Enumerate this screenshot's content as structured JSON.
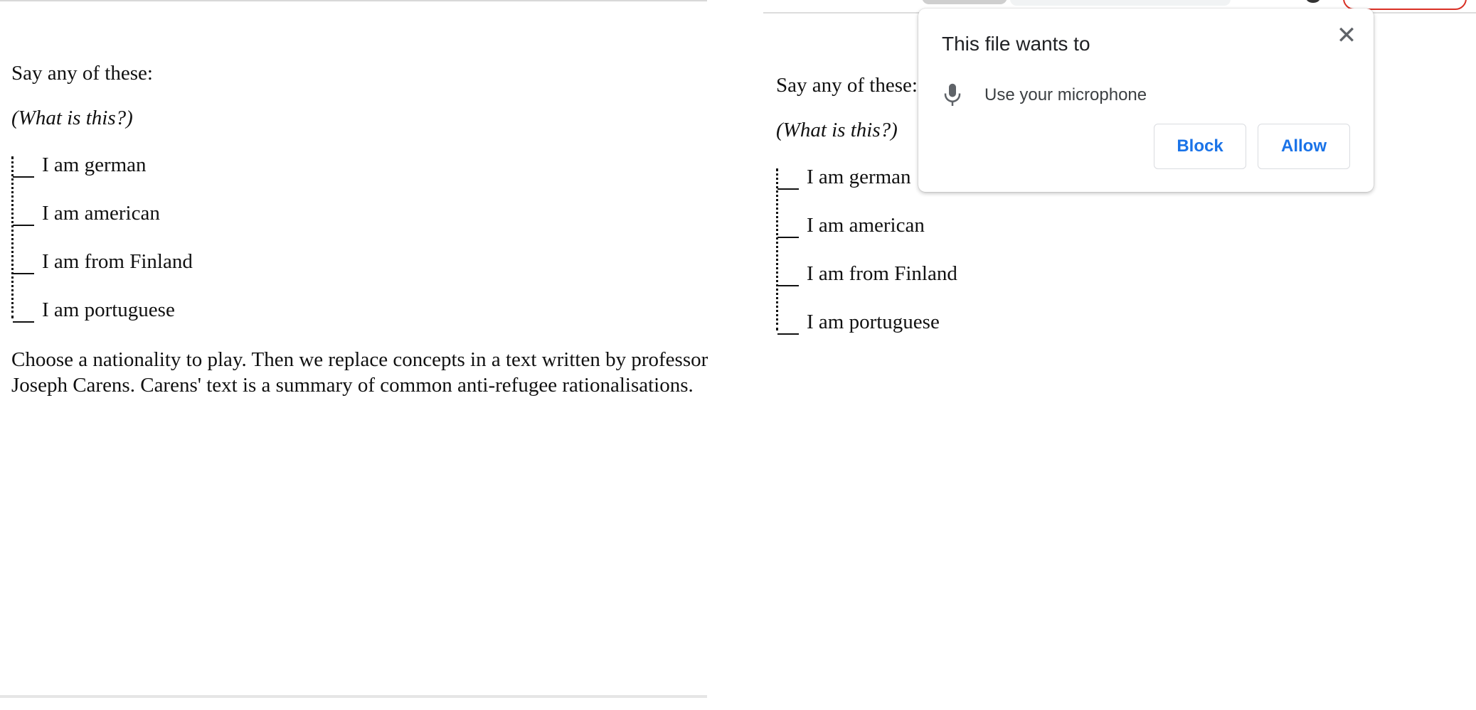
{
  "left_page": {
    "prompt": "Say any of these:",
    "what_is_this": "(What is this?)",
    "options": [
      "I am german",
      "I am american",
      "I am from Finland",
      "I am portuguese"
    ],
    "description": "Choose a nationality to play. Then we replace concepts in a text written by professor Joseph Carens. Carens' text is a summary of common anti-refugee rationalisations."
  },
  "right_page": {
    "prompt": "Say any of these:",
    "what_is_this": "(What is this?)",
    "options": [
      "I am german",
      "I am american",
      "I am from Finland",
      "I am portuguese"
    ]
  },
  "permission_popup": {
    "title": "This file wants to",
    "permission": "Use your microphone",
    "permission_icon": "microphone-icon",
    "close_icon": "close-icon",
    "block_label": "Block",
    "allow_label": "Allow",
    "button_color": "#1a73e8"
  }
}
